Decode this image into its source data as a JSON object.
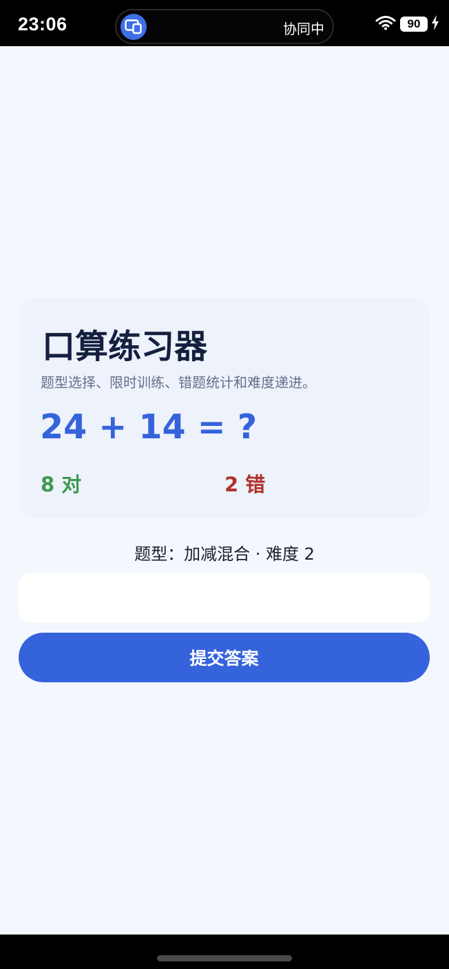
{
  "status_bar": {
    "time": "23:06",
    "collab_text": "协同中",
    "battery": "90",
    "icons": [
      "screen-share-icon",
      "wifi-icon",
      "battery-icon",
      "charging-icon"
    ]
  },
  "card": {
    "title": "口算练习器",
    "subtitle": "题型选择、限时训练、错题统计和难度递进。",
    "question": "24 + 14 = ?",
    "correct_label": "8 对",
    "wrong_label": "2 错"
  },
  "info_line": "题型：加减混合 · 难度 2",
  "answer": {
    "value": "",
    "placeholder": ""
  },
  "submit_label": "提交答案",
  "colors": {
    "accent": "#3563db",
    "correct": "#3f9a4f",
    "wrong": "#b0312a",
    "background": "#f4f7fe",
    "card": "#edf2fb"
  }
}
